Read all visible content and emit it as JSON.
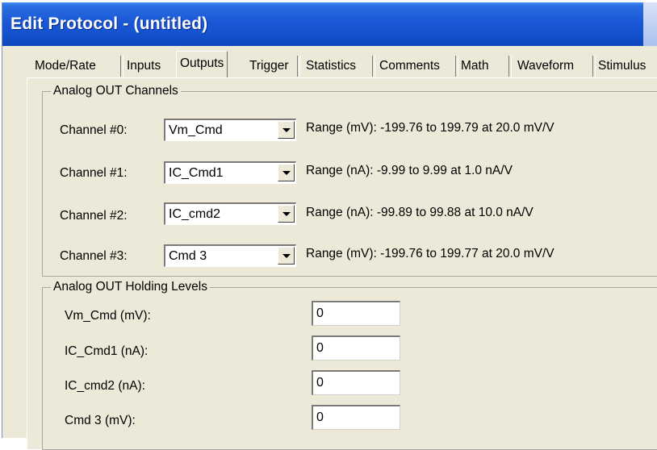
{
  "window": {
    "title": "Edit Protocol - (untitled)"
  },
  "tabs": [
    {
      "label": "Mode/Rate",
      "active": false
    },
    {
      "label": "Inputs",
      "active": false
    },
    {
      "label": "Outputs",
      "active": true
    },
    {
      "label": "Trigger",
      "active": false
    },
    {
      "label": "Statistics",
      "active": false
    },
    {
      "label": "Comments",
      "active": false
    },
    {
      "label": "Math",
      "active": false
    },
    {
      "label": "Waveform",
      "active": false
    },
    {
      "label": "Stimulus",
      "active": false
    }
  ],
  "analog_out_channels": {
    "label": "Analog OUT Channels",
    "channels": [
      {
        "label": "Channel #0:",
        "value": "Vm_Cmd",
        "range": "Range (mV): -199.76 to 199.79 at 20.0 mV/V"
      },
      {
        "label": "Channel #1:",
        "value": "IC_Cmd1",
        "range": "Range (nA): -9.99 to 9.99 at 1.0 nA/V"
      },
      {
        "label": "Channel #2:",
        "value": "IC_cmd2",
        "range": "Range (nA): -99.89 to 99.88 at 10.0 nA/V"
      },
      {
        "label": "Channel #3:",
        "value": "Cmd 3",
        "range": "Range (mV): -199.76 to 199.77 at 20.0 mV/V"
      }
    ]
  },
  "holding_levels": {
    "label": "Analog OUT Holding Levels",
    "items": [
      {
        "label": "Vm_Cmd (mV):",
        "value": "0"
      },
      {
        "label": "IC_Cmd1 (nA):",
        "value": "0"
      },
      {
        "label": "IC_cmd2 (nA):",
        "value": "0"
      },
      {
        "label": "Cmd 3 (mV):",
        "value": "0"
      }
    ]
  }
}
